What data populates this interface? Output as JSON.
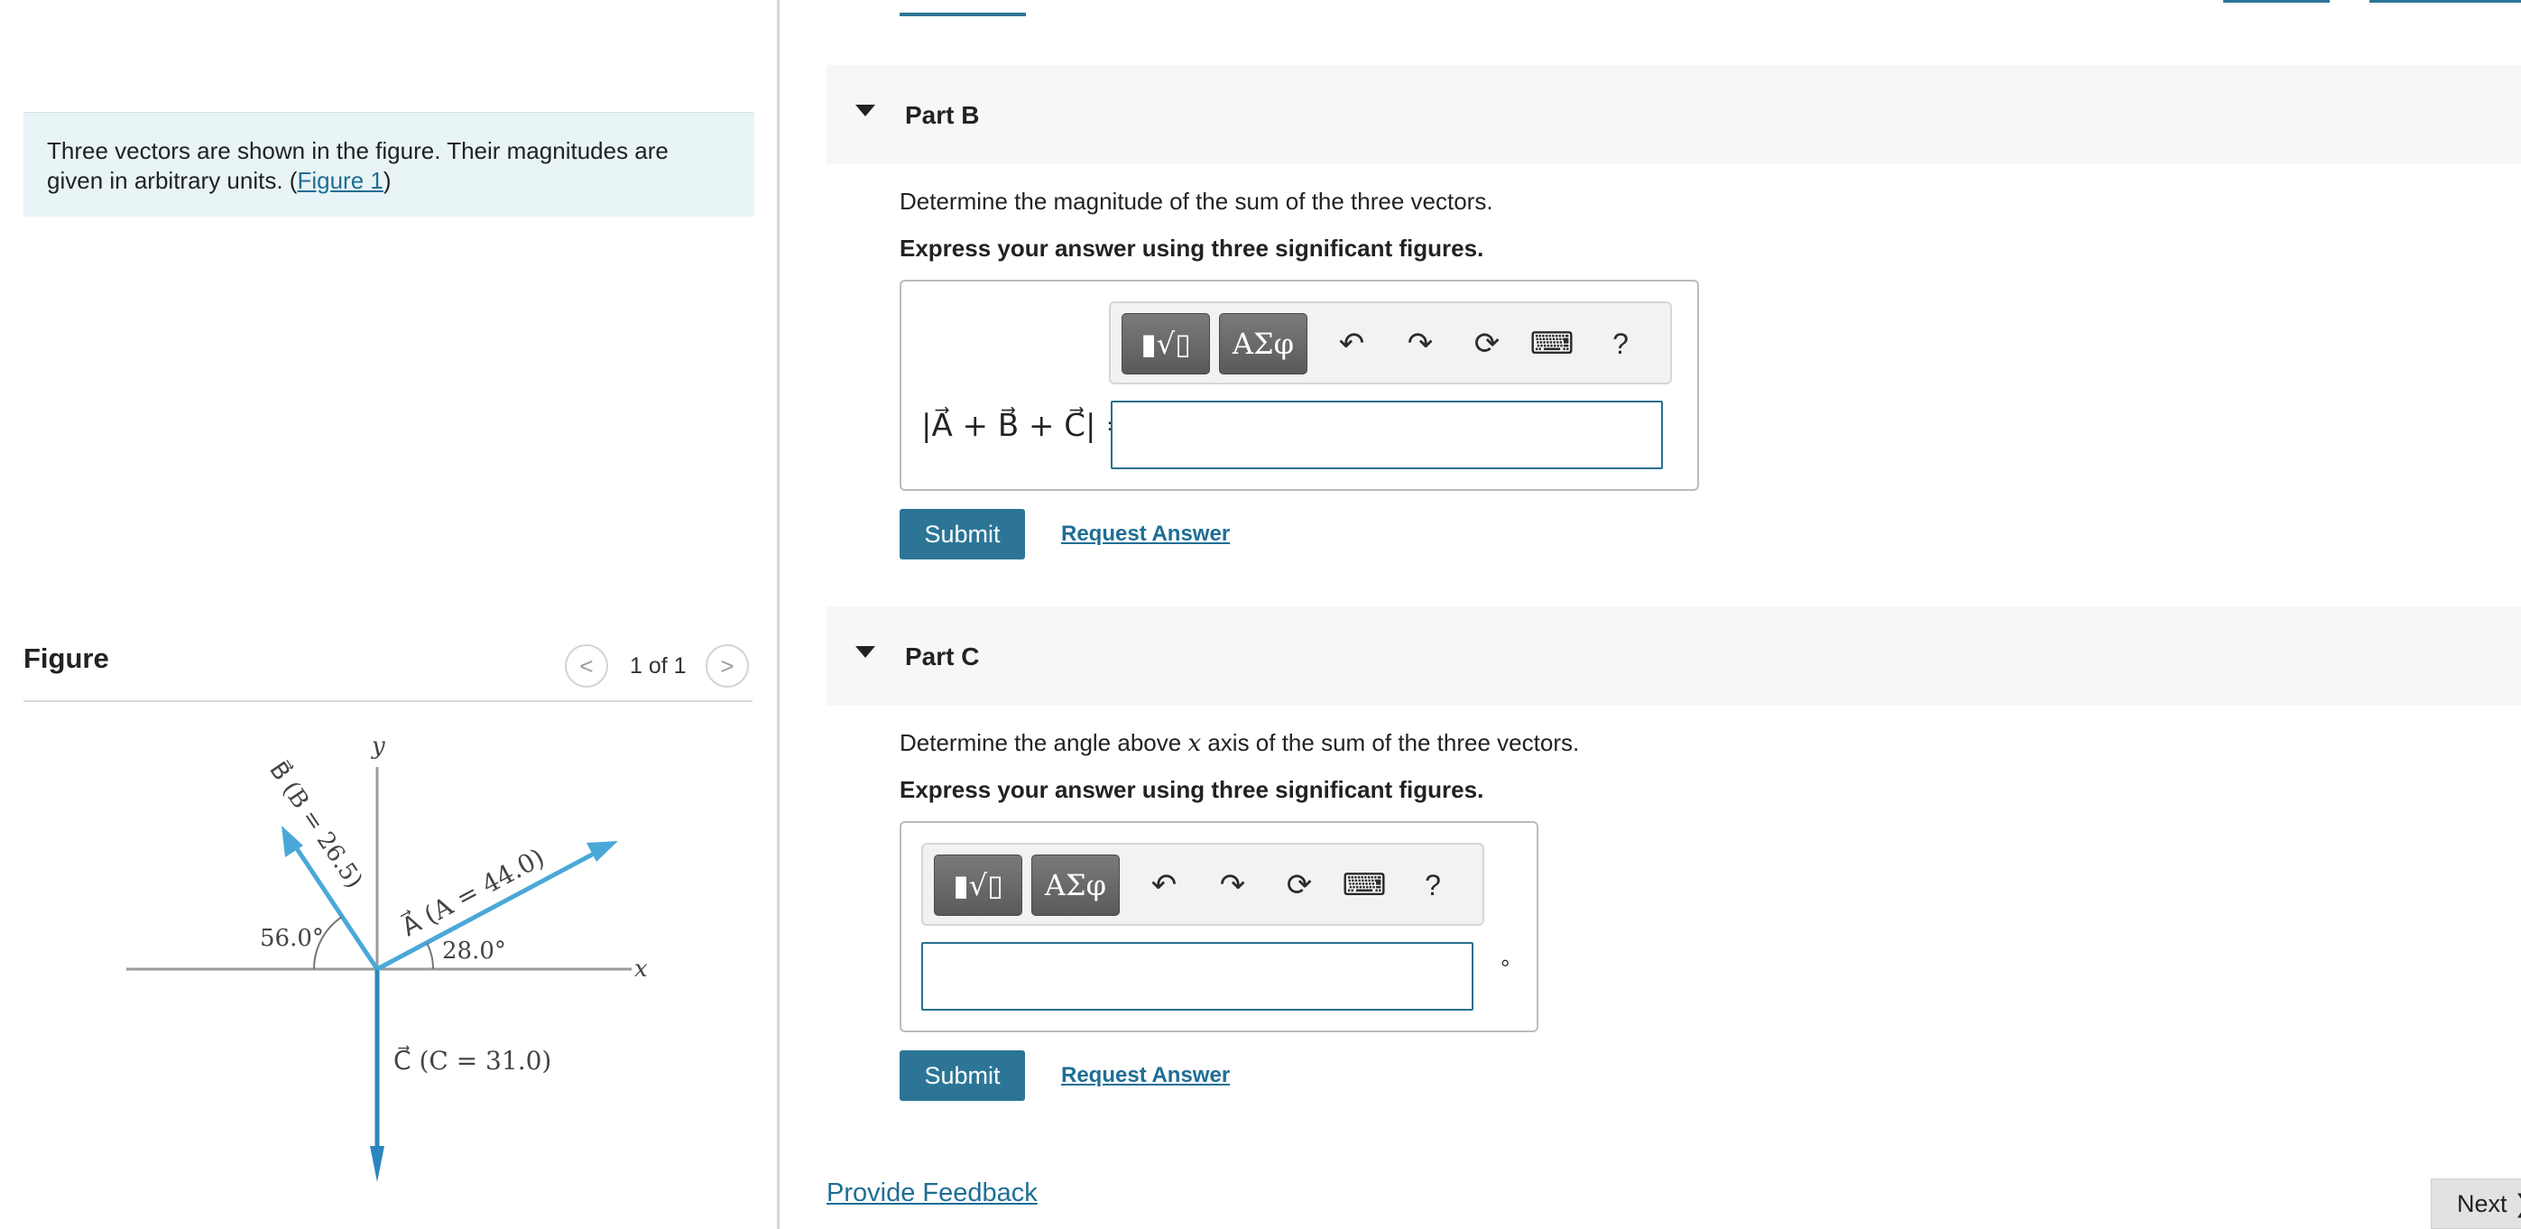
{
  "intro": {
    "text": "Three vectors are shown in the figure. Their magnitudes are given in arbitrary units. (",
    "figure_link": "Figure 1",
    "close": ")"
  },
  "figure": {
    "title": "Figure",
    "pager_prev": "<",
    "pager_text": "1 of 1",
    "pager_next": ">",
    "labels": {
      "y_axis": "y",
      "x_axis": "x",
      "vector_a": "A⃗ (A = 44.0)",
      "vector_b": "B⃗ (B = 26.5)",
      "vector_c": "C⃗ (C = 31.0)",
      "angle_a": "28.0°",
      "angle_b": "56.0°"
    },
    "colors": {
      "vector": "#4aa8d8",
      "vector_dark": "#2a86bd",
      "axis": "#9a9a9a"
    }
  },
  "part_b": {
    "title": "Part B",
    "question": "Determine the magnitude of the sum of the three vectors.",
    "instruction": "Express your answer using three significant figures.",
    "toolbar": {
      "templates_label": "▮√▯",
      "symbols_label": "ΑΣφ",
      "undo": "↶",
      "redo": "↷",
      "reset": "⟳",
      "keyboard": "⌨",
      "help": "?"
    },
    "answer_label": "|A⃗ + B⃗ + C⃗| =",
    "answer_value": "",
    "submit": "Submit",
    "request": "Request Answer"
  },
  "part_c": {
    "title": "Part C",
    "question_before": "Determine the angle above ",
    "question_var": "x",
    "question_after": " axis of the sum of the three vectors.",
    "instruction": "Express your answer using three significant figures.",
    "toolbar": {
      "templates_label": "▮√▯",
      "symbols_label": "ΑΣφ",
      "undo": "↶",
      "redo": "↷",
      "reset": "⟳",
      "keyboard": "⌨",
      "help": "?"
    },
    "answer_value": "",
    "unit": "°",
    "submit": "Submit",
    "request": "Request Answer"
  },
  "footer": {
    "feedback": "Provide Feedback",
    "next": "Next ❯"
  }
}
